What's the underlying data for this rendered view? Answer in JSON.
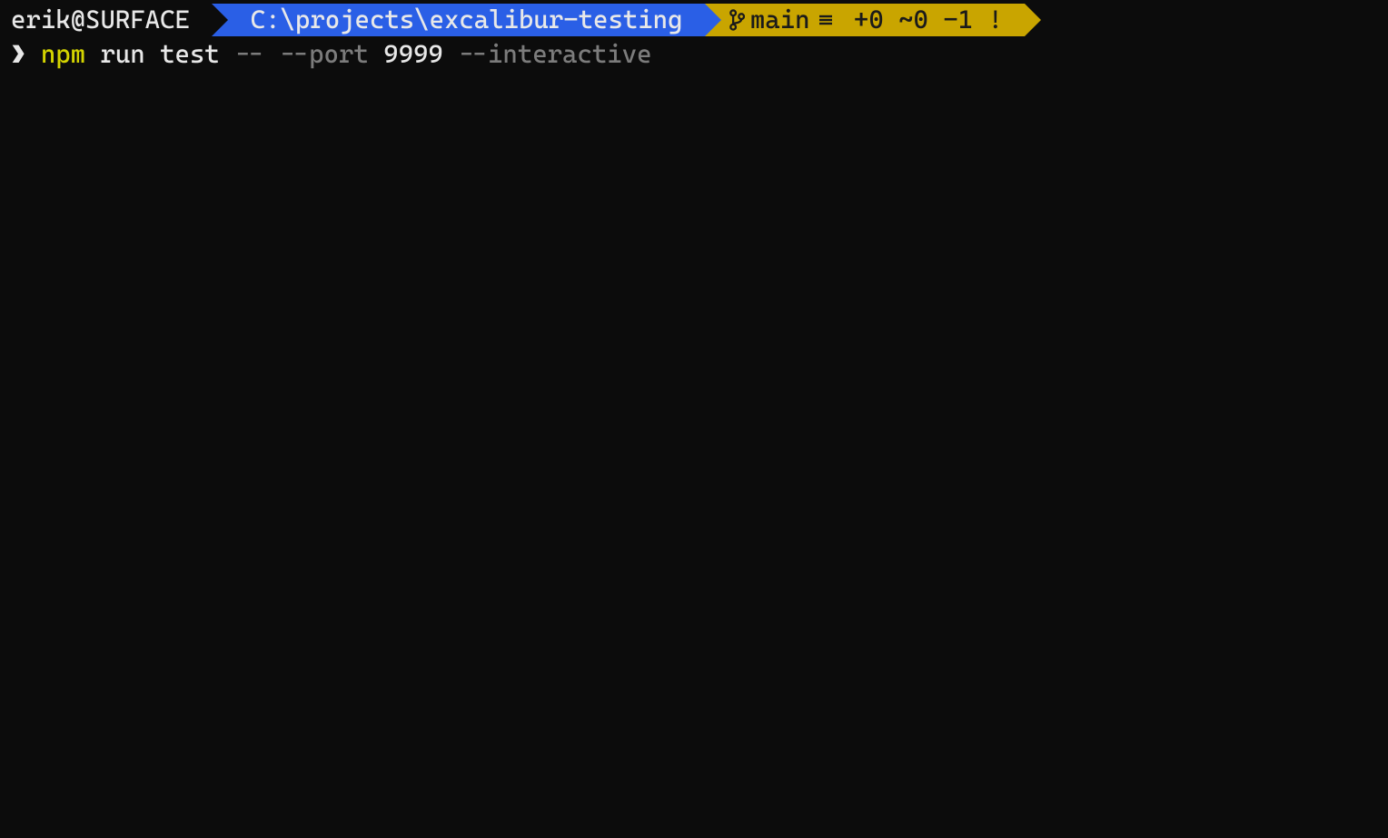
{
  "prompt": {
    "user_host": "erik@SURFACE ",
    "path": " C:\\projects\\excalibur-testing ",
    "git": {
      "branch": "main",
      "status": " +0 ~0 -1 ! "
    }
  },
  "command": {
    "symbol": "❯ ",
    "tok_npm": "npm ",
    "tok_run": "run ",
    "tok_test": "test ",
    "tok_dashdash": "-- ",
    "tok_port_flag": "--port ",
    "tok_port_value": "9999 ",
    "tok_interactive": "--interactive"
  }
}
